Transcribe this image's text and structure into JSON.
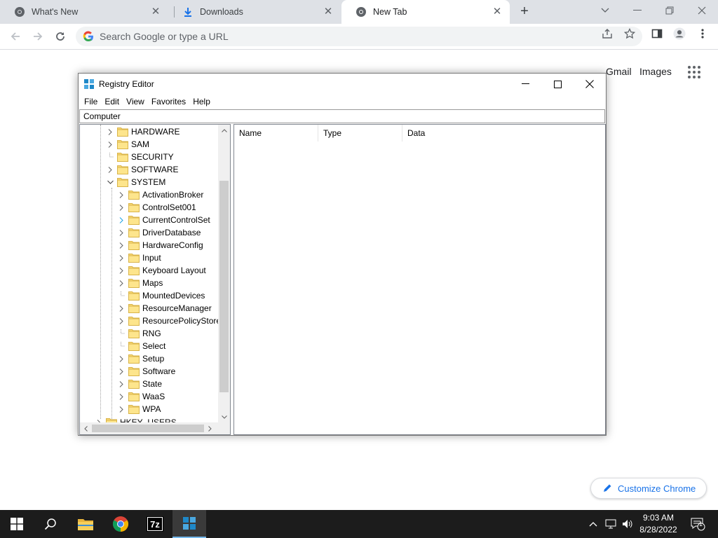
{
  "browser": {
    "tabs": [
      {
        "title": "What's New",
        "icon": "chrome-icon"
      },
      {
        "title": "Downloads",
        "icon": "download-icon"
      },
      {
        "title": "New Tab",
        "icon": "chrome-icon",
        "active": true
      }
    ],
    "omnibox_placeholder": "Search Google or type a URL",
    "accent_color": "#1a73e8"
  },
  "ntp": {
    "gmail": "Gmail",
    "images": "Images",
    "customize": "Customize Chrome"
  },
  "regedit": {
    "title": "Registry Editor",
    "menu": [
      "File",
      "Edit",
      "View",
      "Favorites",
      "Help"
    ],
    "address": "Computer",
    "tree_top": [
      {
        "label": "HARDWARE",
        "expander": "collapsed"
      },
      {
        "label": "SAM",
        "expander": "collapsed"
      },
      {
        "label": "SECURITY",
        "expander": "none"
      },
      {
        "label": "SOFTWARE",
        "expander": "collapsed"
      },
      {
        "label": "SYSTEM",
        "expander": "expanded"
      }
    ],
    "tree_system_children": [
      {
        "label": "ActivationBroker",
        "expander": "collapsed"
      },
      {
        "label": "ControlSet001",
        "expander": "collapsed"
      },
      {
        "label": "CurrentControlSet",
        "expander": "hover"
      },
      {
        "label": "DriverDatabase",
        "expander": "collapsed"
      },
      {
        "label": "HardwareConfig",
        "expander": "collapsed"
      },
      {
        "label": "Input",
        "expander": "collapsed"
      },
      {
        "label": "Keyboard Layout",
        "expander": "collapsed"
      },
      {
        "label": "Maps",
        "expander": "collapsed"
      },
      {
        "label": "MountedDevices",
        "expander": "none"
      },
      {
        "label": "ResourceManager",
        "expander": "collapsed"
      },
      {
        "label": "ResourcePolicyStore",
        "expander": "collapsed"
      },
      {
        "label": "RNG",
        "expander": "none"
      },
      {
        "label": "Select",
        "expander": "none"
      },
      {
        "label": "Setup",
        "expander": "collapsed"
      },
      {
        "label": "Software",
        "expander": "collapsed"
      },
      {
        "label": "State",
        "expander": "collapsed"
      },
      {
        "label": "WaaS",
        "expander": "collapsed"
      },
      {
        "label": "WPA",
        "expander": "collapsed"
      }
    ],
    "tree_bottom": {
      "label": "HKEY_USERS",
      "expander": "collapsed"
    },
    "columns": [
      "Name",
      "Type",
      "Data"
    ]
  },
  "taskbar": {
    "time": "9:03 AM",
    "date": "8/28/2022",
    "notification_count": "1",
    "apps": [
      "start-icon",
      "search-icon",
      "file-explorer-icon",
      "chrome-icon",
      "7zip-icon",
      "regedit-icon"
    ]
  }
}
